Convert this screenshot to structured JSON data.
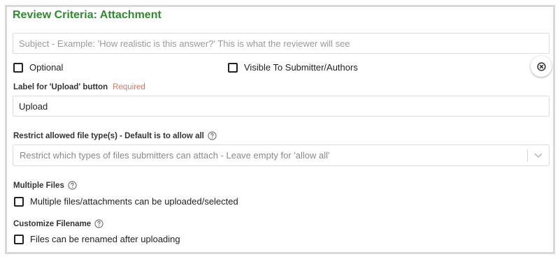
{
  "section": {
    "title": "Review Criteria: Attachment"
  },
  "subject": {
    "placeholder": "Subject - Example: 'How realistic is this answer?' This is what the reviewer will see"
  },
  "options": {
    "optional_label": "Optional",
    "visible_label": "Visible To Submitter/Authors"
  },
  "upload_button": {
    "label": "Label for 'Upload' button",
    "required": "Required",
    "value": "Upload"
  },
  "file_types": {
    "label": "Restrict allowed file type(s) - Default is to allow all",
    "placeholder": "Restrict which types of files submitters can attach - Leave empty for 'allow all'"
  },
  "multiple_files": {
    "label": "Multiple Files",
    "checkbox_label": "Multiple files/attachments can be uploaded/selected"
  },
  "customize_filename": {
    "label": "Customize Filename",
    "checkbox_label": "Files can be renamed after uploading"
  },
  "colors": {
    "title": "#2e8b2e",
    "required": "#d07a6a",
    "border": "#d9d9d9"
  }
}
